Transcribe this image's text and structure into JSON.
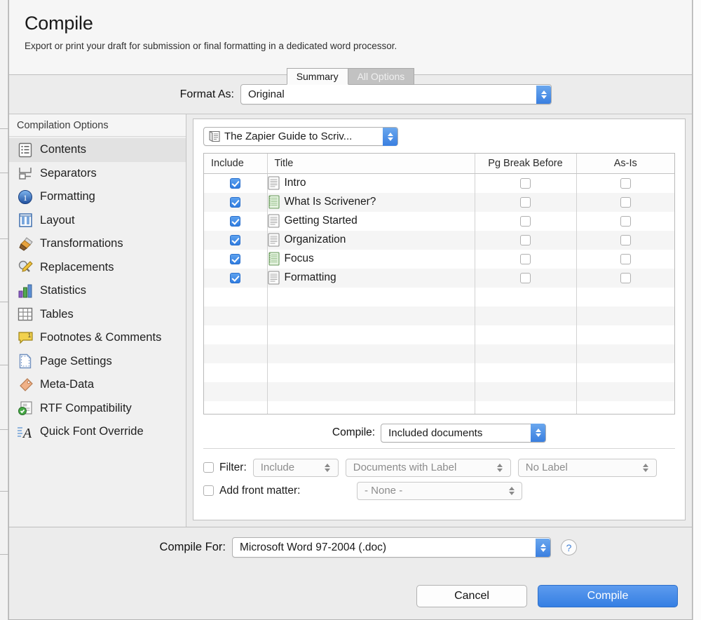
{
  "header": {
    "title": "Compile",
    "subtitle": "Export or print your draft for submission or final formatting in a dedicated word processor."
  },
  "tabs": [
    {
      "label": "Summary",
      "active": true
    },
    {
      "label": "All Options",
      "active": false
    }
  ],
  "format_as": {
    "label": "Format As:",
    "value": "Original"
  },
  "sidebar": {
    "heading": "Compilation Options",
    "items": [
      {
        "label": "Contents",
        "icon": "list-document-icon",
        "selected": true
      },
      {
        "label": "Separators",
        "icon": "separators-icon",
        "selected": false
      },
      {
        "label": "Formatting",
        "icon": "blue-number-circle-icon",
        "selected": false
      },
      {
        "label": "Layout",
        "icon": "layout-columns-icon",
        "selected": false
      },
      {
        "label": "Transformations",
        "icon": "paintbrush-icon",
        "selected": false
      },
      {
        "label": "Replacements",
        "icon": "pencil-magnifier-icon",
        "selected": false
      },
      {
        "label": "Statistics",
        "icon": "bar-chart-icon",
        "selected": false
      },
      {
        "label": "Tables",
        "icon": "table-grid-icon",
        "selected": false
      },
      {
        "label": "Footnotes & Comments",
        "icon": "comment-bubble-icon",
        "selected": false
      },
      {
        "label": "Page Settings",
        "icon": "page-icon",
        "selected": false
      },
      {
        "label": "Meta-Data",
        "icon": "tag-icon",
        "selected": false
      },
      {
        "label": "RTF Compatibility",
        "icon": "rtf-check-icon",
        "selected": false
      },
      {
        "label": "Quick Font Override",
        "icon": "font-a-icon",
        "selected": false
      }
    ]
  },
  "document_selector": {
    "icon": "document-stack-icon",
    "value": "The Zapier Guide to Scriv..."
  },
  "table": {
    "columns": [
      "Include",
      "Title",
      "Pg Break Before",
      "As-Is"
    ],
    "rows": [
      {
        "include": true,
        "icon": "text-document-icon",
        "title": "Intro",
        "pg_break_before": false,
        "as_is": false
      },
      {
        "include": true,
        "icon": "green-notebook-icon",
        "title": "What Is Scrivener?",
        "pg_break_before": false,
        "as_is": false
      },
      {
        "include": true,
        "icon": "text-document-icon",
        "title": "Getting Started",
        "pg_break_before": false,
        "as_is": false
      },
      {
        "include": true,
        "icon": "text-document-icon",
        "title": "Organization",
        "pg_break_before": false,
        "as_is": false
      },
      {
        "include": true,
        "icon": "green-notebook-icon",
        "title": "Focus",
        "pg_break_before": false,
        "as_is": false
      },
      {
        "include": true,
        "icon": "text-document-icon",
        "title": "Formatting",
        "pg_break_before": false,
        "as_is": false
      }
    ],
    "empty_row_count": 7
  },
  "compile_scope": {
    "label": "Compile:",
    "value": "Included documents"
  },
  "filter": {
    "label": "Filter:",
    "checked": false,
    "mode": "Include",
    "criterion": "Documents with Label",
    "label_value": "No Label"
  },
  "front_matter": {
    "label": "Add front matter:",
    "checked": false,
    "value": "- None -"
  },
  "compile_for": {
    "label": "Compile For:",
    "value": "Microsoft Word 97-2004 (.doc)",
    "help": "?"
  },
  "buttons": {
    "cancel": "Cancel",
    "compile": "Compile"
  },
  "colors": {
    "accent_blue": "#3a7fe0",
    "window_bg": "#ececec",
    "panel_bg": "#ffffff",
    "sidebar_bg": "#f0f0f0"
  }
}
